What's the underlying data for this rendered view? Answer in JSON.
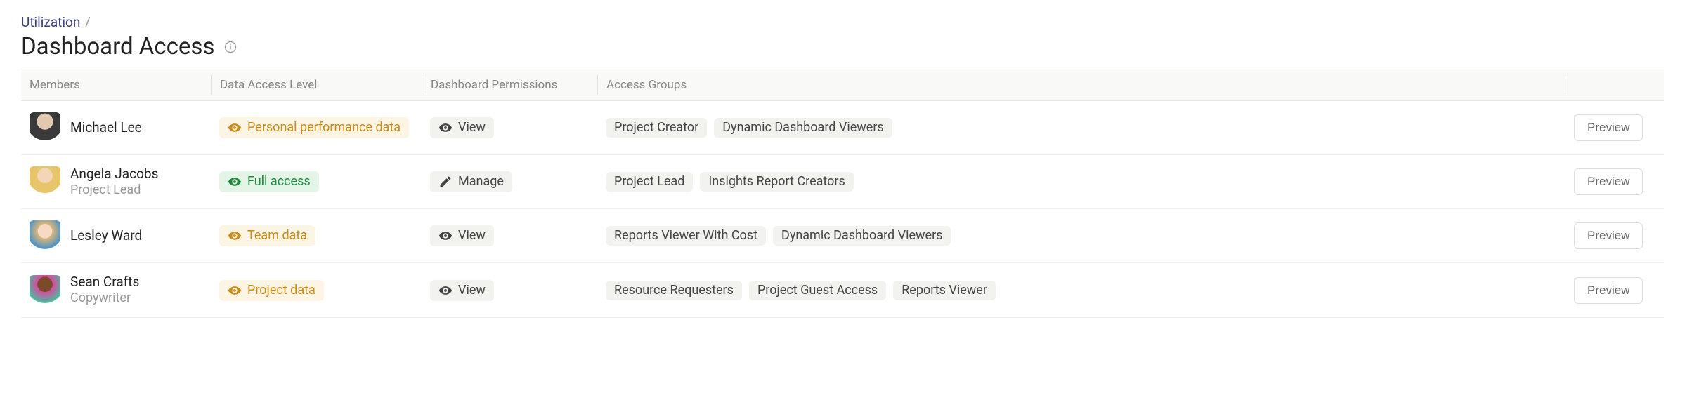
{
  "breadcrumb": {
    "parent": "Utilization",
    "separator": "/"
  },
  "page_title": "Dashboard Access",
  "columns": {
    "members": "Members",
    "access": "Data Access Level",
    "perm": "Dashboard Permissions",
    "groups": "Access Groups"
  },
  "rows": [
    {
      "name": "Michael Lee",
      "role": "",
      "access_label": "Personal performance data",
      "access_variant": "personal",
      "perm_label": "View",
      "perm_icon": "eye",
      "groups": [
        "Project Creator",
        "Dynamic Dashboard Viewers"
      ],
      "action": "Preview"
    },
    {
      "name": "Angela Jacobs",
      "role": "Project Lead",
      "access_label": "Full access",
      "access_variant": "full",
      "perm_label": "Manage",
      "perm_icon": "pencil",
      "groups": [
        "Project Lead",
        "Insights Report Creators"
      ],
      "action": "Preview"
    },
    {
      "name": "Lesley Ward",
      "role": "",
      "access_label": "Team data",
      "access_variant": "team",
      "perm_label": "View",
      "perm_icon": "eye",
      "groups": [
        "Reports Viewer With Cost",
        "Dynamic Dashboard Viewers"
      ],
      "action": "Preview"
    },
    {
      "name": "Sean Crafts",
      "role": "Copywriter",
      "access_label": "Project data",
      "access_variant": "project",
      "perm_label": "View",
      "perm_icon": "eye",
      "groups": [
        "Resource Requesters",
        "Project Guest Access",
        "Reports Viewer"
      ],
      "action": "Preview"
    }
  ]
}
